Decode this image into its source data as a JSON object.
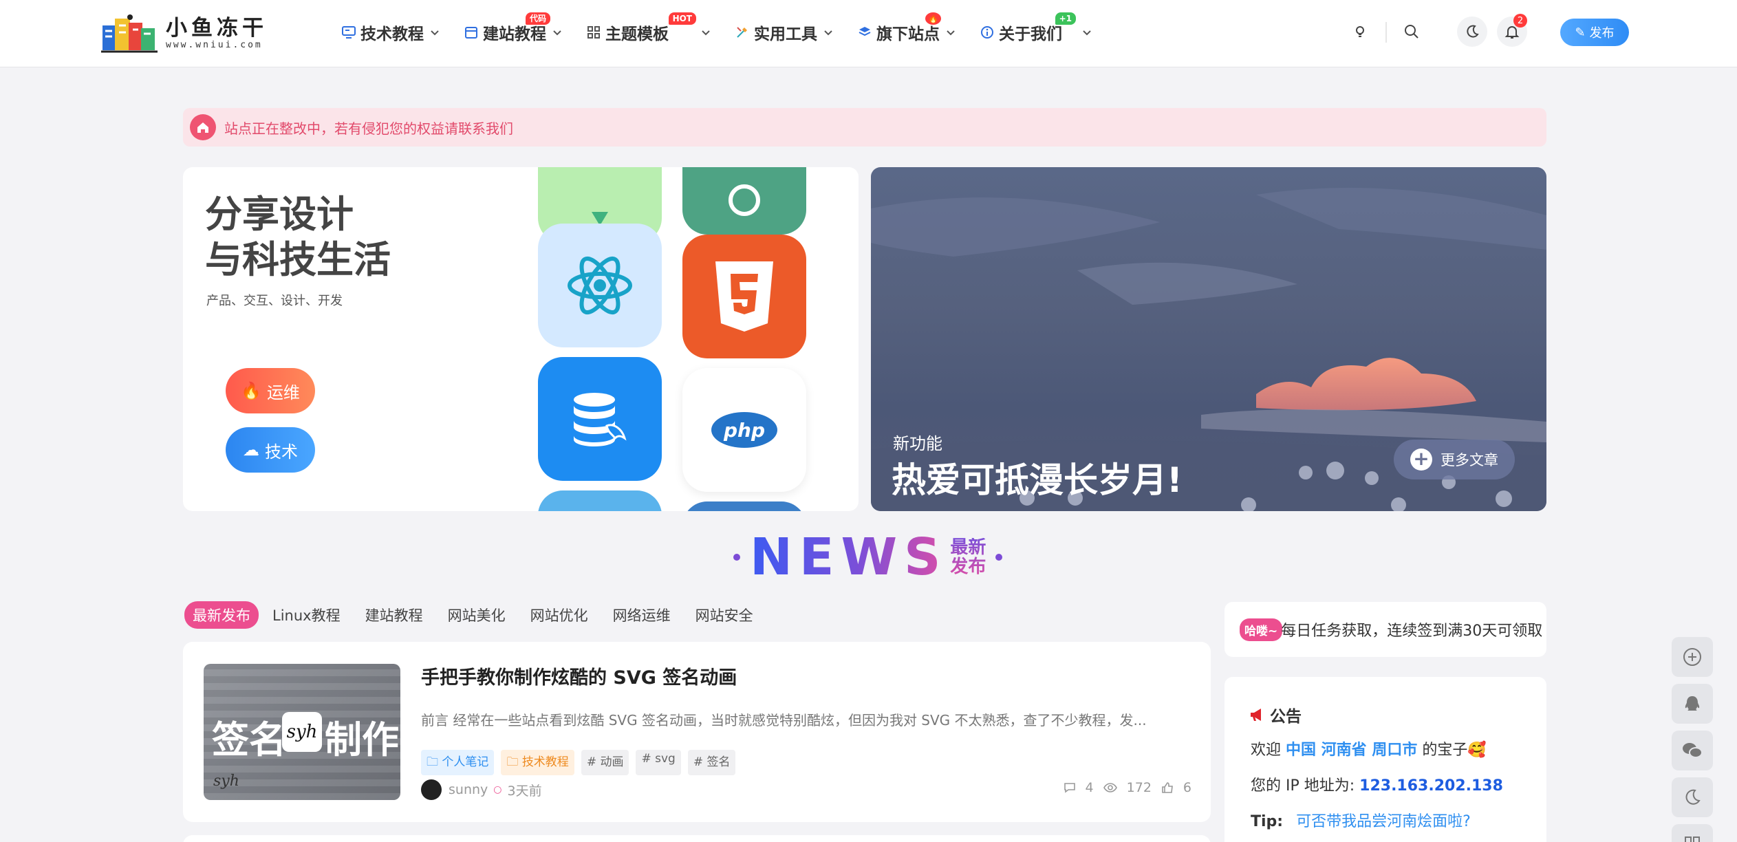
{
  "brand": {
    "title": "小鱼冻干",
    "subtitle": "www.wniui.com"
  },
  "nav": [
    {
      "label": "技术教程",
      "icon": "monitor-icon",
      "badge": ""
    },
    {
      "label": "建站教程",
      "icon": "calendar-icon",
      "badge": "代码",
      "badge_color": "#ff3b3b"
    },
    {
      "label": "主题模板",
      "icon": "grid-icon",
      "badge": "HOT",
      "badge_color": "#ff3b3b"
    },
    {
      "label": "实用工具",
      "icon": "tools-icon",
      "badge": ""
    },
    {
      "label": "旗下站点",
      "icon": "layers-icon",
      "badge": "🔥",
      "badge_color": "#ff3b3b"
    },
    {
      "label": "关于我们",
      "icon": "info-icon",
      "badge": "+1",
      "badge_color": "#3cc35b"
    }
  ],
  "header": {
    "notification_count": "2",
    "publish_label": "发布"
  },
  "notice": {
    "text": "站点正在整改中，若有侵犯您的权益请联系我们"
  },
  "hero_left": {
    "title_line1": "分享设计",
    "title_line2": "与科技生活",
    "subtitle": "产品、交互、设计、开发",
    "pill1": "运维",
    "pill2": "技术",
    "tiles": [
      "vue-icon",
      "openai-icon",
      "react-icon",
      "html5-icon",
      "database-icon",
      "php-icon"
    ]
  },
  "hero_right": {
    "label": "新功能",
    "title": "热爱可抵漫长岁月!",
    "more": "更多文章"
  },
  "news": {
    "word": "NEWS",
    "sub1": "最新",
    "sub2": "发布"
  },
  "tabs": [
    "最新发布",
    "Linux教程",
    "建站教程",
    "网站美化",
    "网站优化",
    "网络运维",
    "网站安全"
  ],
  "article": {
    "title": "手把手教你制作炫酷的 SVG 签名动画",
    "excerpt": "前言 经常在一些站点看到炫酷 SVG 签名动画，当时就感觉特别酷炫，但因为我对 SVG 不太熟悉，查了不少教程，发...",
    "thumb_text_left": "签名",
    "thumb_text_mid": "syh",
    "thumb_text_right": "制作",
    "thumb_corner": "syh",
    "tags": [
      {
        "label": "个人笔记",
        "style": "blue"
      },
      {
        "label": "技术教程",
        "style": "orange"
      },
      {
        "label": "# 动画",
        "style": "gray"
      },
      {
        "label": "# svg",
        "style": "gray"
      },
      {
        "label": "# 签名",
        "style": "gray"
      }
    ],
    "author": "sunny",
    "time": "3天前",
    "comments": "4",
    "views": "172",
    "likes": "6"
  },
  "sidebar": {
    "signin_badge": "哈喽~",
    "signin_text": "每日任务获取，连续签到满30天可领取",
    "announce_title": "公告",
    "welcome_prefix": "欢迎",
    "welcome_location": "中国 河南省 周口市",
    "welcome_suffix": "的宝子🥰",
    "ip_label": "您的 IP 地址为:",
    "ip_value": "123.163.202.138",
    "tip_label": "Tip:",
    "tip_text": "可否带我品尝河南烩面啦?"
  },
  "colors": {
    "accent_pink": "#ec4e8f",
    "accent_blue": "#2f8cf5",
    "notice_bg": "#fbe4e9",
    "notice_text": "#e24a6b"
  }
}
